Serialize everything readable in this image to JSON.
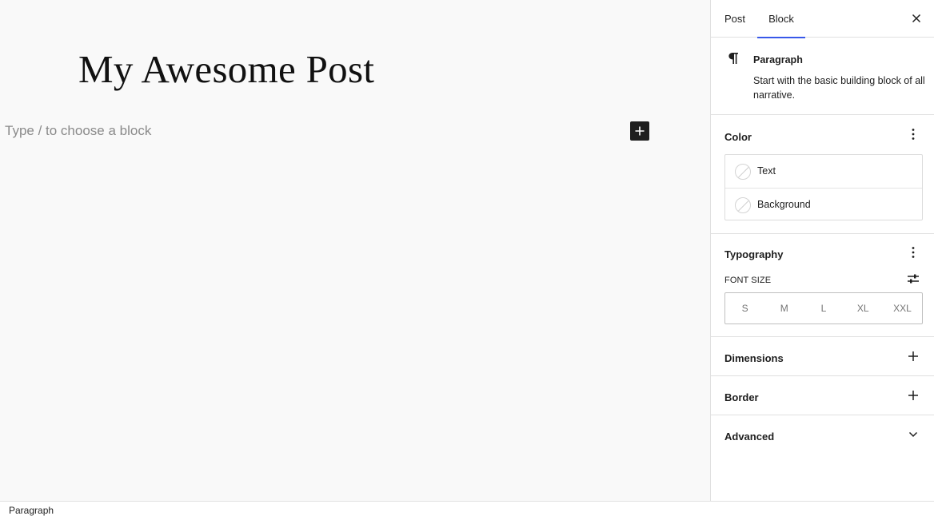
{
  "editor": {
    "title": "My Awesome Post",
    "placeholder": "Type / to choose a block",
    "inserter_icon": "plus-icon"
  },
  "sidebar": {
    "tabs": [
      {
        "label": "Post",
        "active": false
      },
      {
        "label": "Block",
        "active": true
      }
    ],
    "close_icon": "close-icon",
    "block": {
      "icon": "paragraph-icon",
      "name": "Paragraph",
      "description": "Start with the basic building block of all narrative."
    },
    "color": {
      "title": "Color",
      "items": [
        {
          "label": "Text"
        },
        {
          "label": "Background"
        }
      ]
    },
    "typography": {
      "title": "Typography",
      "font_size_label": "FONT SIZE",
      "sizes": [
        "S",
        "M",
        "L",
        "XL",
        "XXL"
      ]
    },
    "dimensions": {
      "title": "Dimensions"
    },
    "border": {
      "title": "Border"
    },
    "advanced": {
      "title": "Advanced"
    }
  },
  "footer": {
    "breadcrumb": "Paragraph"
  },
  "colors": {
    "accent": "#3858e9",
    "text": "#1e1e1e",
    "placeholder": "#8a8a8a",
    "border": "#e0e0e0"
  }
}
